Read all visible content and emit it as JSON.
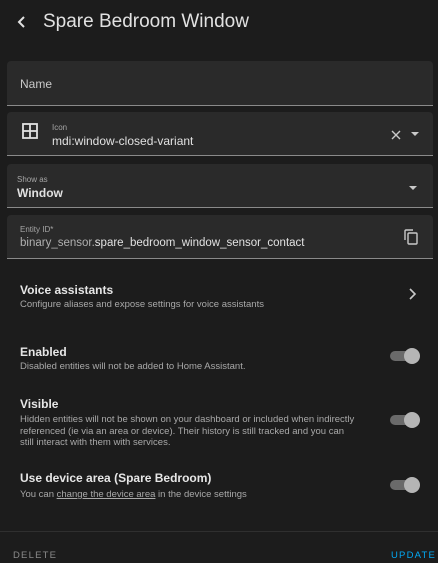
{
  "header": {
    "title": "Spare Bedroom Window"
  },
  "fields": {
    "name": {
      "placeholder": "Name"
    },
    "icon": {
      "label": "Icon",
      "value": "mdi:window-closed-variant"
    },
    "show_as": {
      "label": "Show as",
      "value": "Window"
    },
    "entity_id": {
      "label": "Entity ID*",
      "prefix": "binary_sensor.",
      "value": "spare_bedroom_window_sensor_contact"
    }
  },
  "voice": {
    "title": "Voice assistants",
    "desc": "Configure aliases and expose settings for voice assistants"
  },
  "enabled": {
    "title": "Enabled",
    "desc": "Disabled entities will not be added to Home Assistant."
  },
  "visible": {
    "title": "Visible",
    "desc": "Hidden entities will not be shown on your dashboard or included when indirectly referenced (ie via an area or device). Their history is still tracked and you can still interact with them with services."
  },
  "device_area": {
    "title": "Use device area (Spare Bedroom)",
    "desc_before": "You can ",
    "link": "change the device area",
    "desc_after": " in the device settings"
  },
  "footer": {
    "delete_label": "DELETE",
    "update_label": "UPDATE"
  },
  "colors": {
    "accent": "#03a9f4",
    "delete": "#8a8a8a"
  }
}
